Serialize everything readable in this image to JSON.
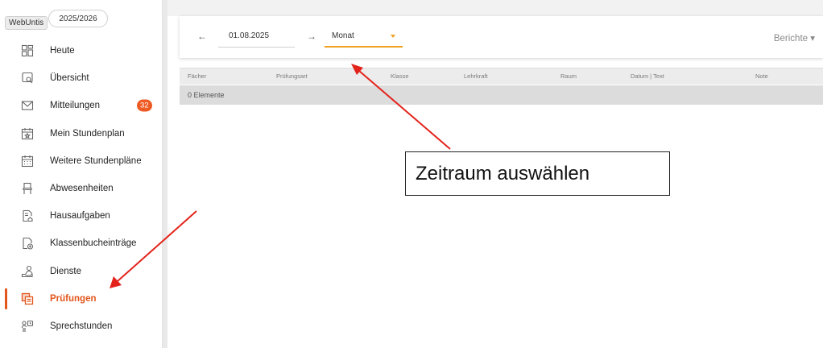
{
  "app": {
    "brand": "WebUntis",
    "school_year": "2025/2026"
  },
  "sidebar": {
    "items": [
      {
        "label": "Heute",
        "icon": "dashboard-icon"
      },
      {
        "label": "Übersicht",
        "icon": "overview-icon"
      },
      {
        "label": "Mitteilungen",
        "icon": "mail-icon",
        "badge": "32"
      },
      {
        "label": "Mein Stundenplan",
        "icon": "calendar-star-icon"
      },
      {
        "label": "Weitere Stundenpläne",
        "icon": "calendar-grid-icon"
      },
      {
        "label": "Abwesenheiten",
        "icon": "chair-icon"
      },
      {
        "label": "Hausaufgaben",
        "icon": "homework-icon"
      },
      {
        "label": "Klassenbucheinträge",
        "icon": "classbook-icon"
      },
      {
        "label": "Dienste",
        "icon": "duty-icon"
      },
      {
        "label": "Prüfungen",
        "icon": "exams-icon",
        "active": true
      },
      {
        "label": "Sprechstunden",
        "icon": "consultation-icon"
      }
    ]
  },
  "toolbar": {
    "date_value": "01.08.2025",
    "period_value": "Monat",
    "reports_label": "Berichte ▾"
  },
  "table": {
    "columns": [
      "Fächer",
      "Prüfungsart",
      "Klasse",
      "Lehrkraft",
      "Raum",
      "Datum | Text",
      "Note"
    ],
    "count_text": "0 Elemente"
  },
  "annotation": {
    "callout_text": "Zeitraum auswählen",
    "arrow_color": "#e3231b"
  },
  "colors": {
    "accent": "#e2551b",
    "badge": "#ee5a24",
    "select_underline": "#f0a020"
  }
}
